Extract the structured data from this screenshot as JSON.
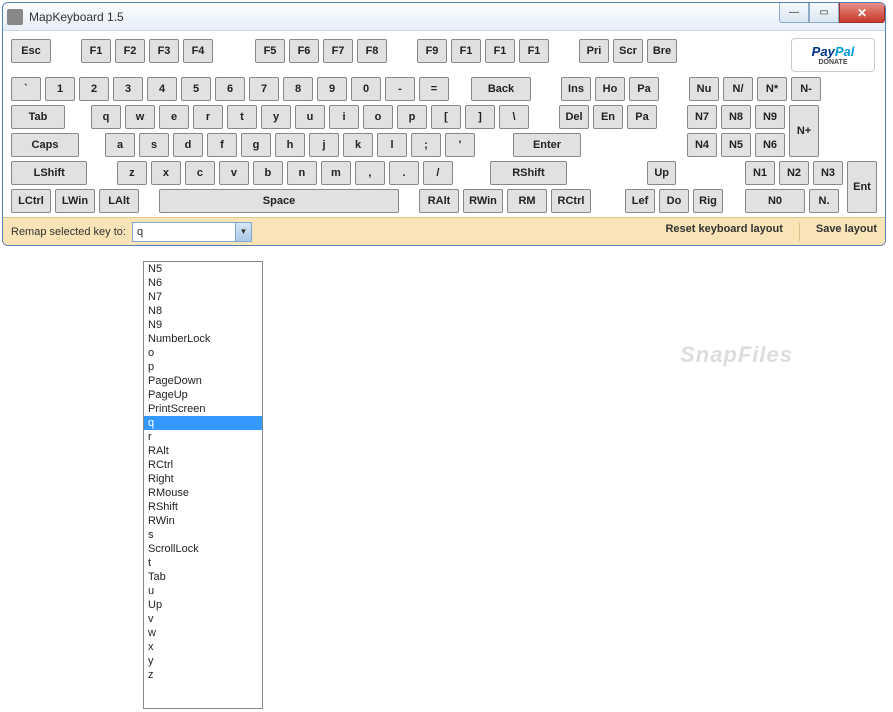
{
  "window": {
    "title": "MapKeyboard 1.5"
  },
  "paypal": {
    "brand_pay": "Pay",
    "brand_pal": "Pal",
    "donate": "DONATE"
  },
  "rows": {
    "fn1": [
      "Esc"
    ],
    "fn2": [
      "F1",
      "F2",
      "F3",
      "F4"
    ],
    "fn3": [
      "F5",
      "F6",
      "F7",
      "F8"
    ],
    "fn4": [
      "F9",
      "F1",
      "F1",
      "F1"
    ],
    "fn5": [
      "Pri",
      "Scr",
      "Bre"
    ],
    "num_row": [
      "`",
      "1",
      "2",
      "3",
      "4",
      "5",
      "6",
      "7",
      "8",
      "9",
      "0",
      "-",
      "="
    ],
    "back": "Back",
    "ins_row": [
      "Ins",
      "Ho",
      "Pa"
    ],
    "numtop": [
      "Nu",
      "N/",
      "N*",
      "N-"
    ],
    "tab": "Tab",
    "qwerty": [
      "q",
      "w",
      "e",
      "r",
      "t",
      "y",
      "u",
      "i",
      "o",
      "p",
      "[",
      "]",
      "\\"
    ],
    "del_row": [
      "Del",
      "En",
      "Pa"
    ],
    "num789": [
      "N7",
      "N8",
      "N9"
    ],
    "numplus": "N+",
    "caps": "Caps",
    "asdf": [
      "a",
      "s",
      "d",
      "f",
      "g",
      "h",
      "j",
      "k",
      "l",
      ";",
      "'"
    ],
    "enter": "Enter",
    "num456": [
      "N4",
      "N5",
      "N6"
    ],
    "lshift": "LShift",
    "zxcv": [
      "z",
      "x",
      "c",
      "v",
      "b",
      "n",
      "m",
      ",",
      ".",
      "/"
    ],
    "rshift": "RShift",
    "up": "Up",
    "num123": [
      "N1",
      "N2",
      "N3"
    ],
    "nument": "Ent",
    "bottom_left": [
      "LCtrl",
      "LWin",
      "LAlt"
    ],
    "space": "Space",
    "bottom_right": [
      "RAlt",
      "RWin",
      "RM",
      "RCtrl"
    ],
    "arrows": [
      "Lef",
      "Do",
      "Rig"
    ],
    "num0": [
      "N0",
      "N."
    ]
  },
  "remap": {
    "label": "Remap selected key to:",
    "value": "q",
    "reset": "Reset keyboard layout",
    "save": "Save layout"
  },
  "dropdown": {
    "options": [
      "N5",
      "N6",
      "N7",
      "N8",
      "N9",
      "NumberLock",
      "o",
      "p",
      "PageDown",
      "PageUp",
      "PrintScreen",
      "q",
      "r",
      "RAlt",
      "RCtrl",
      "Right",
      "RMouse",
      "RShift",
      "RWin",
      "s",
      "ScrollLock",
      "t",
      "Tab",
      "u",
      "Up",
      "v",
      "w",
      "x",
      "y",
      "z"
    ],
    "selected": "q"
  },
  "watermark": "SnapFiles"
}
